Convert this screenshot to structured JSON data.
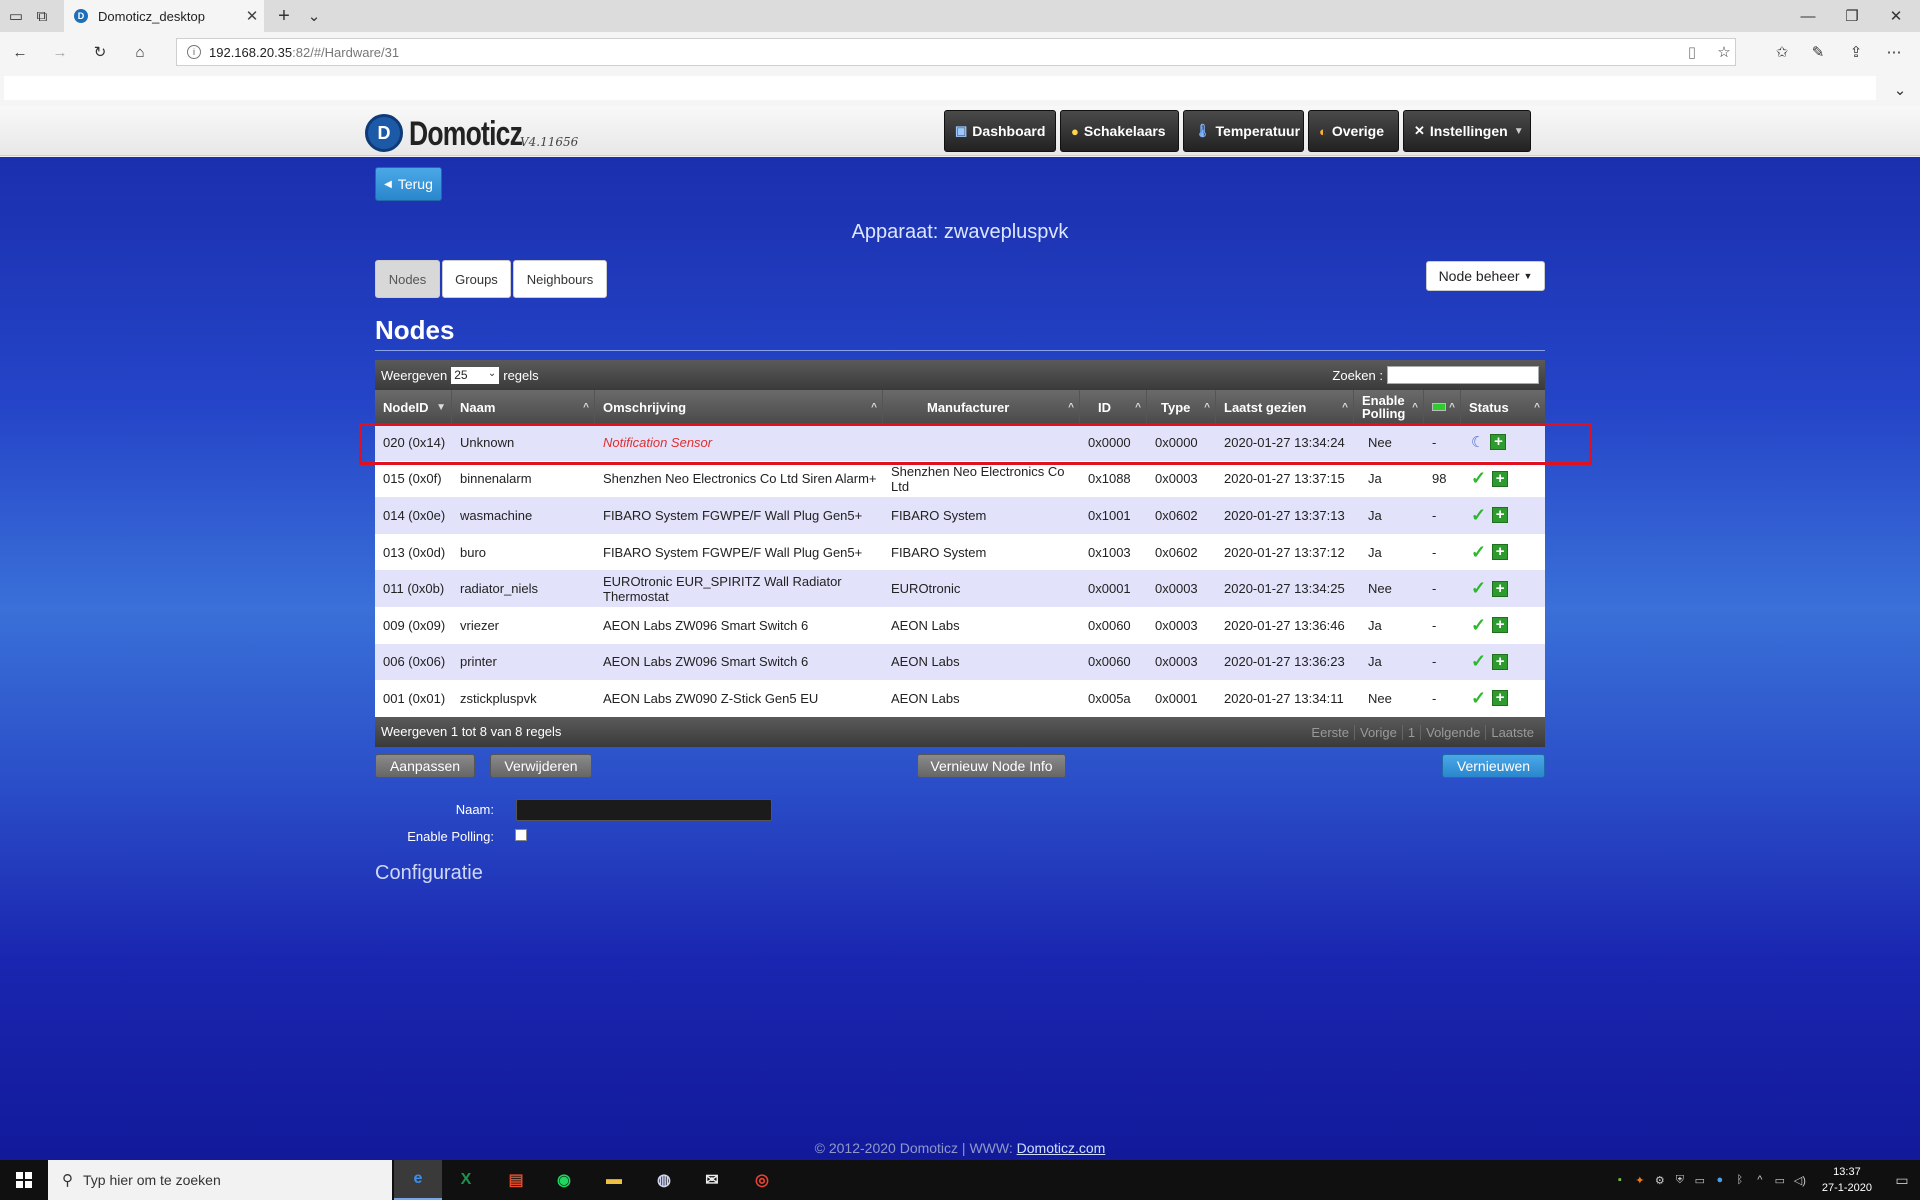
{
  "browser": {
    "tab_title": "Domoticz_desktop",
    "url_host": "192.168.20.35",
    "url_rest": ":82/#/Hardware/31"
  },
  "app": {
    "logo_text": "Domoticz",
    "version": "V4.11656",
    "nav": [
      "Dashboard",
      "Schakelaars",
      "Temperatuur",
      "Overige",
      "Instellingen"
    ]
  },
  "page": {
    "back_label": "Terug",
    "device_title": "Apparaat: zwavepluspvk",
    "tabs": [
      "Nodes",
      "Groups",
      "Neighbours"
    ],
    "node_beheer": "Node beheer",
    "heading": "Nodes"
  },
  "table": {
    "show_label": "Weergeven",
    "page_length": "25",
    "rows_label": "regels",
    "search_label": "Zoeken :",
    "columns": [
      "NodeID",
      "Naam",
      "Omschrijving",
      "Manufacturer",
      "ID",
      "Type",
      "Laatst gezien",
      "Enable Polling",
      "",
      "Status"
    ],
    "rows": [
      {
        "nodeid": "020 (0x14)",
        "naam": "Unknown",
        "omschrijving": "Notification Sensor",
        "manufacturer": "",
        "id": "0x0000",
        "type": "0x0000",
        "laatst": "2020-01-27 13:34:24",
        "polling": "Nee",
        "battery": "-",
        "status": "sleep"
      },
      {
        "nodeid": "015 (0x0f)",
        "naam": "binnenalarm",
        "omschrijving": "Shenzhen Neo Electronics Co Ltd Siren Alarm+",
        "manufacturer": "Shenzhen Neo Electronics Co Ltd",
        "id": "0x1088",
        "type": "0x0003",
        "laatst": "2020-01-27 13:37:15",
        "polling": "Ja",
        "battery": "98",
        "status": "ok"
      },
      {
        "nodeid": "014 (0x0e)",
        "naam": "wasmachine",
        "omschrijving": "FIBARO System FGWPE/F Wall Plug Gen5+",
        "manufacturer": "FIBARO System",
        "id": "0x1001",
        "type": "0x0602",
        "laatst": "2020-01-27 13:37:13",
        "polling": "Ja",
        "battery": "-",
        "status": "ok"
      },
      {
        "nodeid": "013 (0x0d)",
        "naam": "buro",
        "omschrijving": "FIBARO System FGWPE/F Wall Plug Gen5+",
        "manufacturer": "FIBARO System",
        "id": "0x1003",
        "type": "0x0602",
        "laatst": "2020-01-27 13:37:12",
        "polling": "Ja",
        "battery": "-",
        "status": "ok"
      },
      {
        "nodeid": "011 (0x0b)",
        "naam": "radiator_niels",
        "omschrijving": "EUROtronic EUR_SPIRITZ Wall Radiator Thermostat",
        "manufacturer": "EUROtronic",
        "id": "0x0001",
        "type": "0x0003",
        "laatst": "2020-01-27 13:34:25",
        "polling": "Nee",
        "battery": "-",
        "status": "ok"
      },
      {
        "nodeid": "009 (0x09)",
        "naam": "vriezer",
        "omschrijving": "AEON Labs ZW096 Smart Switch 6",
        "manufacturer": "AEON Labs",
        "id": "0x0060",
        "type": "0x0003",
        "laatst": "2020-01-27 13:36:46",
        "polling": "Ja",
        "battery": "-",
        "status": "ok"
      },
      {
        "nodeid": "006 (0x06)",
        "naam": "printer",
        "omschrijving": "AEON Labs ZW096 Smart Switch 6",
        "manufacturer": "AEON Labs",
        "id": "0x0060",
        "type": "0x0003",
        "laatst": "2020-01-27 13:36:23",
        "polling": "Ja",
        "battery": "-",
        "status": "ok"
      },
      {
        "nodeid": "001 (0x01)",
        "naam": "zstickpluspvk",
        "omschrijving": "AEON Labs ZW090 Z-Stick Gen5 EU",
        "manufacturer": "AEON Labs",
        "id": "0x005a",
        "type": "0x0001",
        "laatst": "2020-01-27 13:34:11",
        "polling": "Nee",
        "battery": "-",
        "status": "ok"
      }
    ],
    "info": "Weergeven 1 tot 8 van 8 regels",
    "pager": [
      "Eerste",
      "Vorige",
      "1",
      "Volgende",
      "Laatste"
    ]
  },
  "actions": {
    "edit": "Aanpassen",
    "delete": "Verwijderen",
    "refresh_info": "Vernieuw Node Info",
    "refresh": "Vernieuwen"
  },
  "form": {
    "name_label": "Naam:",
    "polling_label": "Enable Polling:",
    "config_heading": "Configuratie"
  },
  "footer": {
    "copyright": "© 2012-2020 Domoticz | WWW: ",
    "link": "Domoticz.com"
  },
  "taskbar": {
    "search_placeholder": "Typ hier om te zoeken",
    "time": "13:37",
    "date": "27-1-2020"
  },
  "colors": {
    "highlight": "#e01020",
    "status_ok": "#2db82d",
    "notification_text": "#e03030"
  }
}
